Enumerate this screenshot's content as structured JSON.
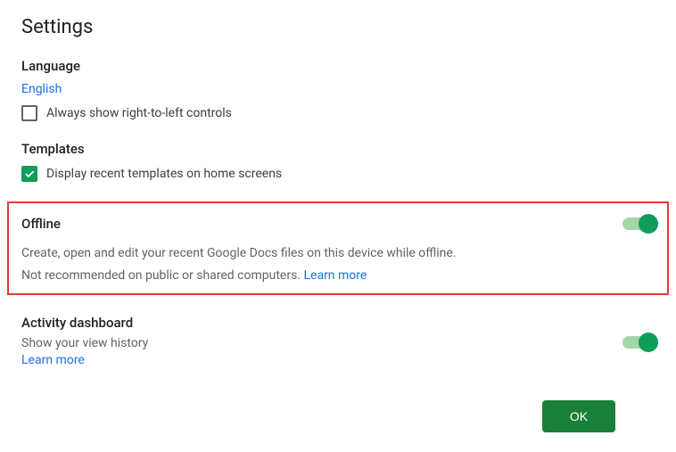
{
  "title": "Settings",
  "language": {
    "heading": "Language",
    "value": "English",
    "rtlCheckbox": "Always show right-to-left controls",
    "rtlChecked": false
  },
  "templates": {
    "heading": "Templates",
    "displayRecent": "Display recent templates on home screens",
    "displayRecentChecked": true
  },
  "offline": {
    "heading": "Offline",
    "desc1": "Create, open and edit your recent Google Docs files on this device while offline.",
    "desc2": "Not recommended on public or shared computers. ",
    "learnMore": "Learn more",
    "enabled": true
  },
  "activity": {
    "heading": "Activity dashboard",
    "subtitle": "Show your view history",
    "learnMore": "Learn more",
    "enabled": true
  },
  "okButton": "OK"
}
